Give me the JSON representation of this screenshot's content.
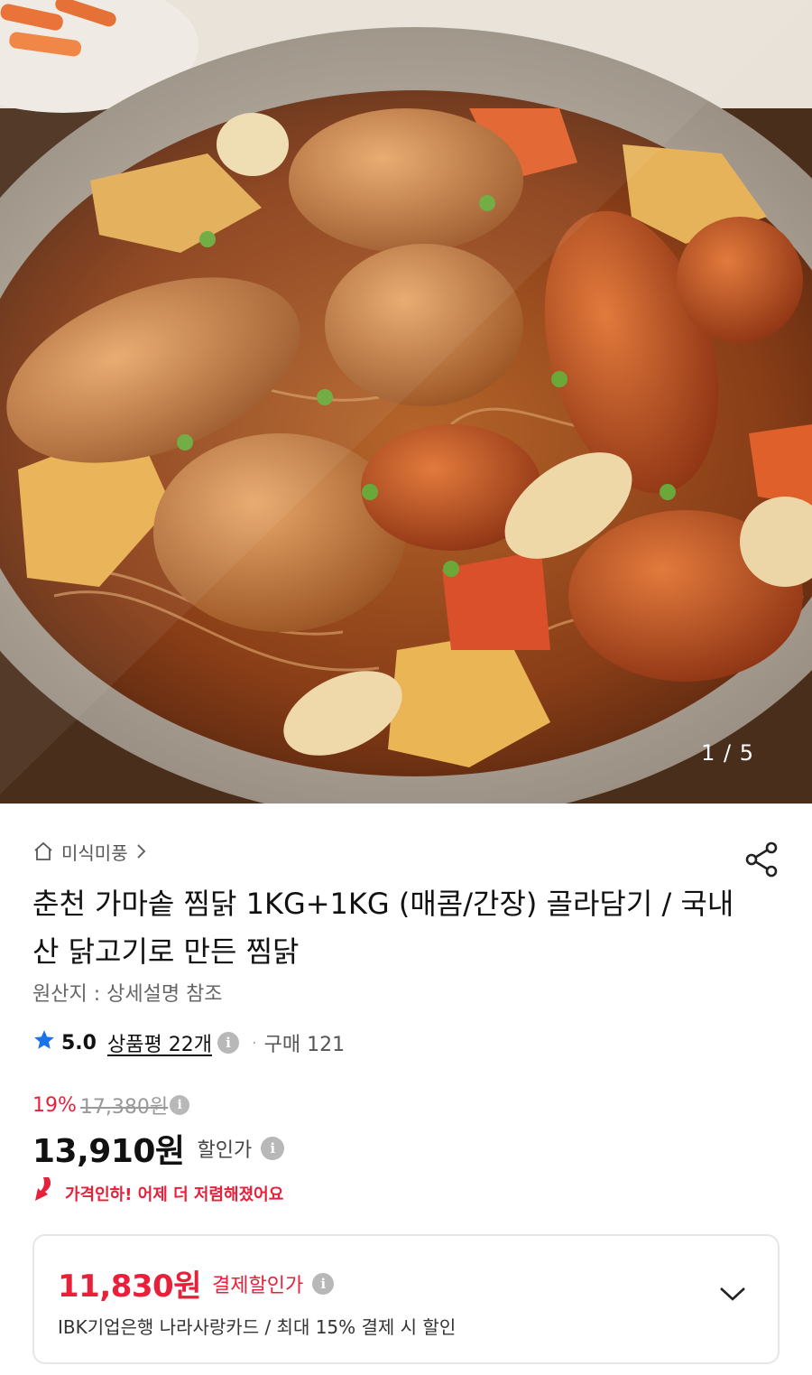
{
  "hero": {
    "image_alt": "찜닭 product photo",
    "counter": "1 / 5"
  },
  "breadcrumb": {
    "store": "미식미풍"
  },
  "product": {
    "title": "춘천 가마솥 찜닭 1KG+1KG (매콤/간장) 골라담기 / 국내산 닭고기로 만든 찜닭",
    "origin": "원산지 : 상세설명 참조"
  },
  "rating": {
    "score": "5.0",
    "reviews": "상품평 22개",
    "purchase": "구매 121",
    "star_color": "#1a73e8"
  },
  "price": {
    "discount_rate": "19%",
    "original": "17,380원",
    "sale": "13,910원",
    "sale_label": "할인가",
    "drop_notice": "가격인하! 어제 더 저렴해졌어요",
    "accent_color": "#e8203a"
  },
  "card_offer": {
    "price": "11,830원",
    "label": "결제할인가",
    "description": "IBK기업은행 나라사랑카드 / 최대 15% 결제 시 할인"
  },
  "icons": {
    "home": "home-icon",
    "chevron_right": "chevron-right-icon",
    "share": "share-icon",
    "star": "star-icon",
    "info": "info-icon",
    "arrow_down": "price-down-arrow-icon",
    "chevron_down": "chevron-down-icon"
  }
}
